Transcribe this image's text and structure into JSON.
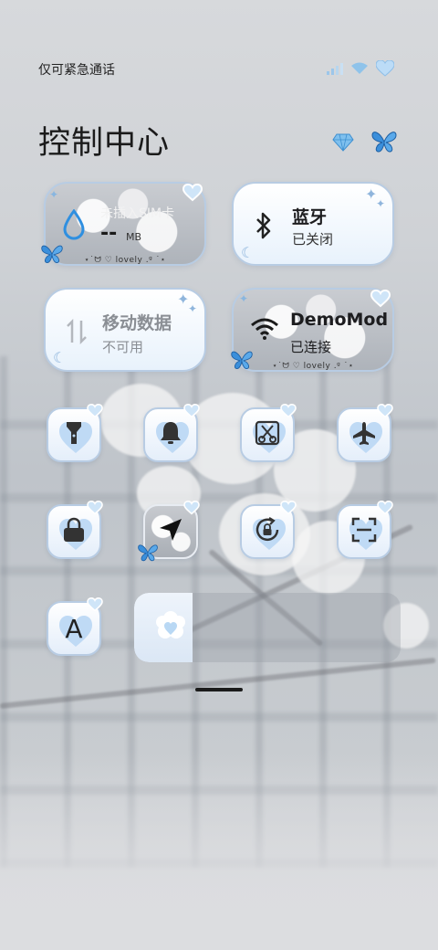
{
  "status_bar": {
    "carrier_text": "仅可紧急通话",
    "icons": [
      "signal-icon",
      "wifi-icon",
      "heart-battery-icon"
    ]
  },
  "title": "控制中心",
  "decorations": [
    "diamond-icon",
    "butterfly-icon"
  ],
  "tiles": {
    "data_usage": {
      "title": "未插入SIM卡",
      "value": "--",
      "unit": "MB",
      "caption": "⋆˙ᗢ ♡ lovely .ᵍ ˙⋆",
      "icon": "water-drop-icon"
    },
    "bluetooth": {
      "title": "蓝牙",
      "status": "已关闭",
      "icon": "bluetooth-icon"
    },
    "mobile_data": {
      "title": "移动数据",
      "status": "不可用",
      "icon": "mobile-data-icon"
    },
    "wifi": {
      "title": "DemoMod",
      "status": "已连接",
      "caption": "⋆˙ᗢ ♡ lovely .ᵍ ˙⋆",
      "icon": "wifi-icon"
    }
  },
  "toggles": [
    {
      "name": "flashlight",
      "icon": "flashlight-icon"
    },
    {
      "name": "mute",
      "icon": "bell-icon"
    },
    {
      "name": "screenshot",
      "icon": "screenshot-scissors-icon"
    },
    {
      "name": "airplane-mode",
      "icon": "airplane-icon"
    },
    {
      "name": "lock-screen",
      "icon": "lock-icon"
    },
    {
      "name": "location",
      "icon": "location-arrow-icon"
    },
    {
      "name": "rotation-lock",
      "icon": "rotation-lock-icon"
    },
    {
      "name": "scanner",
      "icon": "scan-icon"
    },
    {
      "name": "font-size",
      "icon": "font-icon",
      "label": "A"
    }
  ],
  "brightness": {
    "level": 0.22,
    "icon": "heart-cloud-icon"
  },
  "colors": {
    "accent": "#3a8fe0",
    "tile_border": "#b8cce3",
    "heart": "#bfdaf5"
  }
}
